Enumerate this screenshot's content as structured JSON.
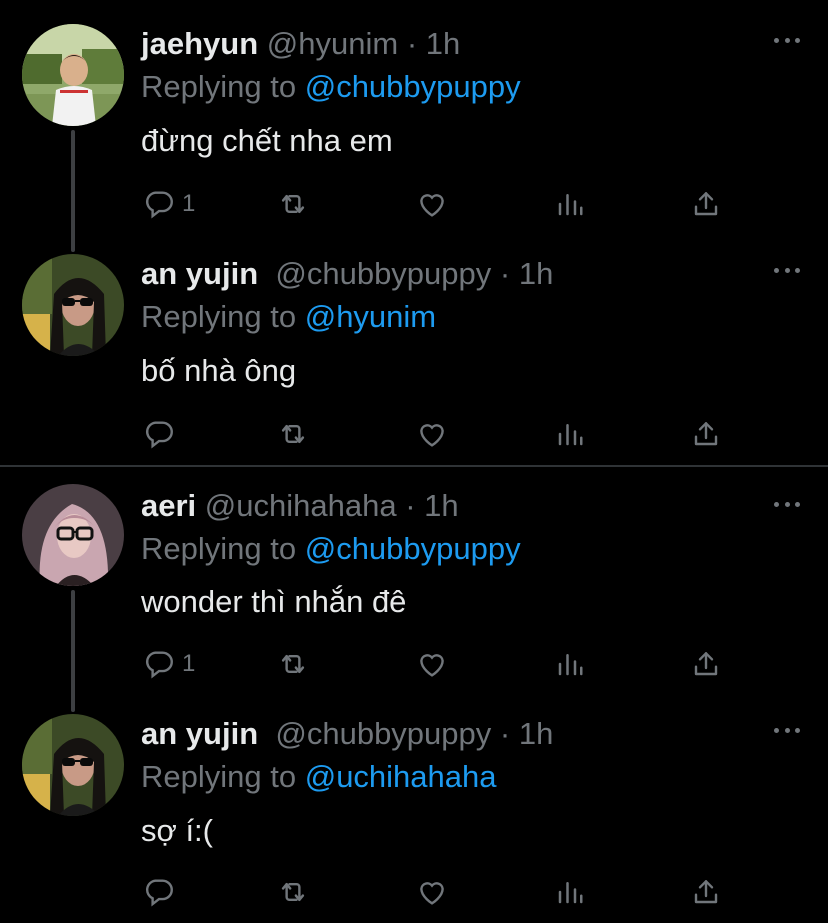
{
  "tweets": [
    {
      "name": "jaehyun",
      "handle": "@hyunim",
      "dot": "·",
      "time": "1h",
      "reply_prefix": "Replying to ",
      "reply_to": "@chubbypuppy",
      "text": "đừng chết nha em",
      "reply_count": "1",
      "avatar_colors": {
        "bg1": "#6f8a4a",
        "bg2": "#c8d6a8",
        "skin": "#d9b08c",
        "shirt": "#f2f2f2"
      }
    },
    {
      "name": "an yujin",
      "handle": "@chubbypuppy",
      "dot": "·",
      "time": "1h",
      "reply_prefix": "Replying to ",
      "reply_to": "@hyunim",
      "text": "bố nhà ông",
      "reply_count": "",
      "avatar_colors": {
        "bg1": "#4a5a2c",
        "bg2": "#d6b24a",
        "skin": "#c89a86",
        "shirt": "#1a1a1a"
      }
    },
    {
      "name": "aeri",
      "handle": "@uchihahaha",
      "dot": "·",
      "time": "1h",
      "reply_prefix": "Replying to ",
      "reply_to": "@chubbypuppy",
      "text": "wonder thì nhắn đê",
      "reply_count": "1",
      "avatar_colors": {
        "bg1": "#5a4a50",
        "bg2": "#c9a6b0",
        "skin": "#e8c9c4",
        "shirt": "#2a2022"
      }
    },
    {
      "name": "an yujin",
      "handle": "@chubbypuppy",
      "dot": "·",
      "time": "1h",
      "reply_prefix": "Replying to ",
      "reply_to": "@uchihahaha",
      "text": "sợ í:(",
      "reply_count": "",
      "avatar_colors": {
        "bg1": "#4a5a2c",
        "bg2": "#d6b24a",
        "skin": "#c89a86",
        "shirt": "#1a1a1a"
      }
    }
  ],
  "icons": {
    "reply": "reply-icon",
    "retweet": "retweet-icon",
    "like": "heart-icon",
    "stats": "stats-icon",
    "share": "share-icon",
    "more": "more-icon"
  },
  "colors": {
    "background": "#000000",
    "text": "#e7e9ea",
    "muted": "#71767b",
    "accent": "#1d9bf0",
    "thread_line": "#3d3f42",
    "divider": "#2f3336"
  }
}
